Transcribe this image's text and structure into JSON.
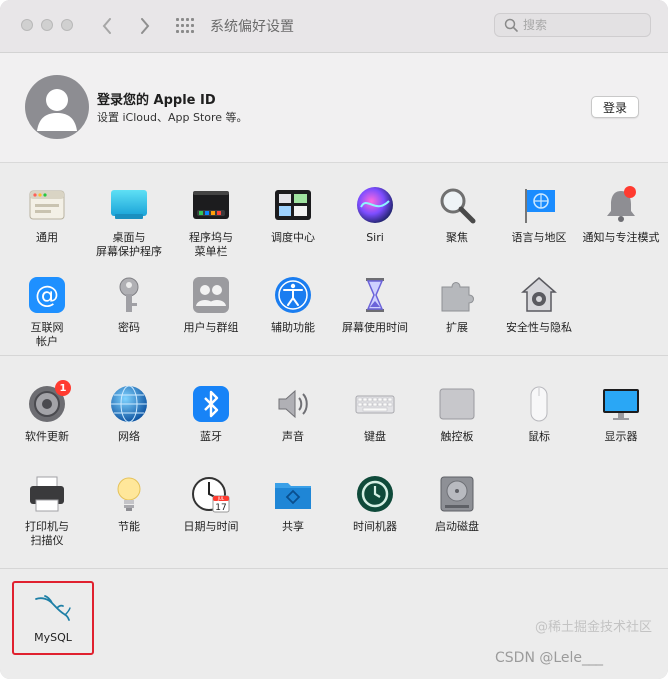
{
  "window": {
    "title": "系统偏好设置"
  },
  "search": {
    "placeholder": "搜索",
    "value": ""
  },
  "apple_id": {
    "title": "登录您的 Apple ID",
    "subtitle": "设置 iCloud、App Store 等。",
    "login_label": "登录"
  },
  "sections": [
    {
      "panes": [
        {
          "label": "通用",
          "icon": "general-icon"
        },
        {
          "label": "桌面与\n屏幕保护程序",
          "icon": "desktop-screensaver-icon"
        },
        {
          "label": "程序坞与\n菜单栏",
          "icon": "dock-menubar-icon"
        },
        {
          "label": "调度中心",
          "icon": "mission-control-icon"
        },
        {
          "label": "Siri",
          "icon": "siri-icon"
        },
        {
          "label": "聚焦",
          "icon": "spotlight-icon"
        },
        {
          "label": "语言与地区",
          "icon": "language-region-icon"
        },
        {
          "label": "通知与专注模式",
          "icon": "notifications-icon"
        },
        {
          "label": "互联网\n帐户",
          "icon": "internet-accounts-icon"
        },
        {
          "label": "密码",
          "icon": "passwords-icon"
        },
        {
          "label": "用户与群组",
          "icon": "users-groups-icon"
        },
        {
          "label": "辅助功能",
          "icon": "accessibility-icon"
        },
        {
          "label": "屏幕使用时间",
          "icon": "screen-time-icon"
        },
        {
          "label": "扩展",
          "icon": "extensions-icon"
        },
        {
          "label": "安全性与隐私",
          "icon": "security-privacy-icon"
        }
      ]
    },
    {
      "panes": [
        {
          "label": "软件更新",
          "icon": "software-update-icon",
          "badge": "1"
        },
        {
          "label": "网络",
          "icon": "network-icon"
        },
        {
          "label": "蓝牙",
          "icon": "bluetooth-icon"
        },
        {
          "label": "声音",
          "icon": "sound-icon"
        },
        {
          "label": "键盘",
          "icon": "keyboard-icon"
        },
        {
          "label": "触控板",
          "icon": "trackpad-icon"
        },
        {
          "label": "鼠标",
          "icon": "mouse-icon"
        },
        {
          "label": "显示器",
          "icon": "displays-icon"
        },
        {
          "label": "打印机与\n扫描仪",
          "icon": "printers-scanners-icon"
        },
        {
          "label": "节能",
          "icon": "energy-saver-icon"
        },
        {
          "label": "日期与时间",
          "icon": "date-time-icon"
        },
        {
          "label": "共享",
          "icon": "sharing-icon"
        },
        {
          "label": "时间机器",
          "icon": "time-machine-icon"
        },
        {
          "label": "启动磁盘",
          "icon": "startup-disk-icon"
        }
      ]
    },
    {
      "panes": [
        {
          "label": "MySQL",
          "icon": "mysql-dolphin-icon"
        }
      ]
    }
  ],
  "calendar": {
    "month": "JUL",
    "day": "17"
  },
  "watermarks": {
    "top": "@稀土掘金技术社区",
    "bottom": "CSDN @Lele___"
  },
  "colors": {
    "highlight_border": "#e0212f",
    "badge": "#ff3b30"
  }
}
